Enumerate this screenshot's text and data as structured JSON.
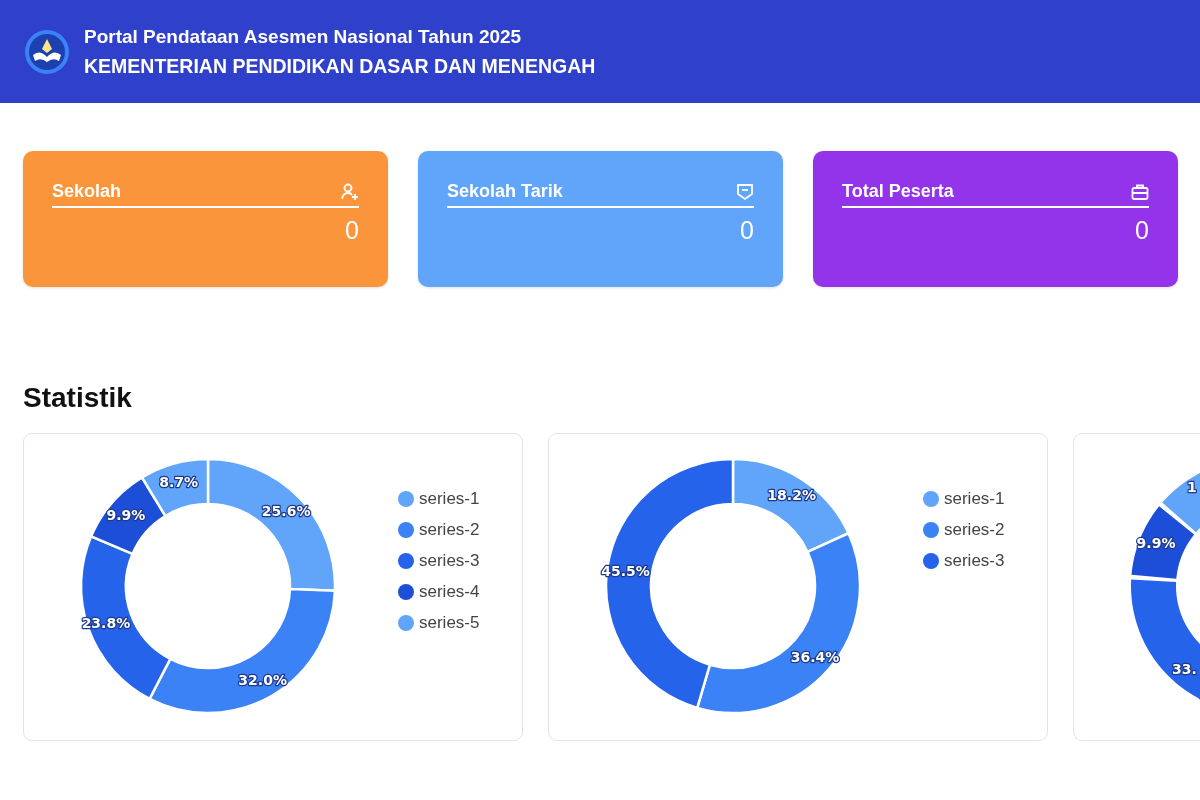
{
  "header": {
    "title": "Portal Pendataan Asesmen Nasional Tahun 2025",
    "subtitle": "KEMENTERIAN PENDIDIKAN DASAR DAN MENENGAH"
  },
  "stat_cards": [
    {
      "label": "Sekolah",
      "value": "0",
      "color": "#fb953b"
    },
    {
      "label": "Sekolah Tarik",
      "value": "0",
      "color": "#60a5fa"
    },
    {
      "label": "Total Peserta",
      "value": "0",
      "color": "#9333ea"
    }
  ],
  "section_title": "Statistik",
  "charts": [
    {
      "chart_data": {
        "type": "donut",
        "categories": [
          "series-1",
          "series-2",
          "series-3",
          "series-4",
          "series-5"
        ],
        "values": [
          25.6,
          32.0,
          23.8,
          9.9,
          8.7
        ],
        "colors": [
          "#60a5fa",
          "#3b82f6",
          "#2563eb",
          "#1d4ed8",
          "#60a5fa"
        ],
        "value_labels": [
          "25.6%",
          "32.0%",
          "23.8%",
          "9.9%",
          "8.7%"
        ],
        "legend": "right"
      }
    },
    {
      "chart_data": {
        "type": "donut",
        "categories": [
          "series-1",
          "series-2",
          "series-3"
        ],
        "values": [
          18.2,
          36.4,
          45.5
        ],
        "colors": [
          "#60a5fa",
          "#3b82f6",
          "#2563eb"
        ],
        "value_labels": [
          "18.2%",
          "36.4%",
          "45.5%"
        ],
        "legend": "right"
      }
    }
  ],
  "partial_chart": {
    "slice_labels": [
      "1",
      "9.9%",
      "33."
    ]
  }
}
